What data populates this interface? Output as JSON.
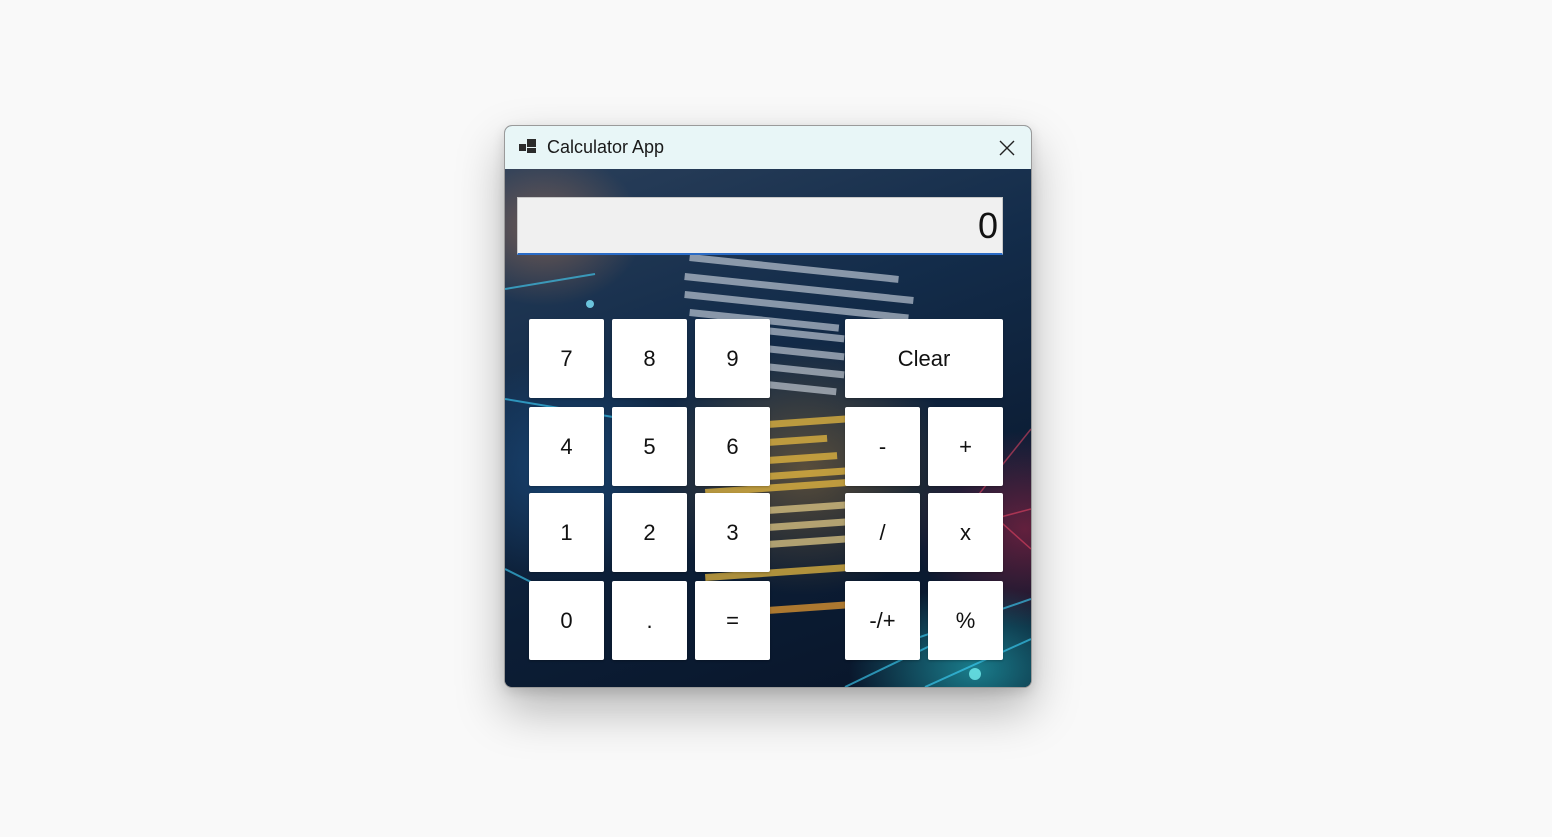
{
  "window": {
    "title": "Calculator App",
    "icon": "app-window-icon",
    "close_icon": "close-icon"
  },
  "display": {
    "value": "0"
  },
  "keys": {
    "k7": "7",
    "k8": "8",
    "k9": "9",
    "clear": "Clear",
    "k4": "4",
    "k5": "5",
    "k6": "6",
    "minus": "-",
    "plus": "+",
    "k1": "1",
    "k2": "2",
    "k3": "3",
    "divide": "/",
    "multiply": "x",
    "k0": "0",
    "dot": ".",
    "equals": "=",
    "negate": "-/+",
    "percent": "%"
  },
  "colors": {
    "titlebar": "#e8f6f7",
    "display_bg": "#f0f0f0",
    "display_accent": "#2a6bc6",
    "key_bg": "#ffffff",
    "desktop_bg": "#f9f9f9"
  }
}
